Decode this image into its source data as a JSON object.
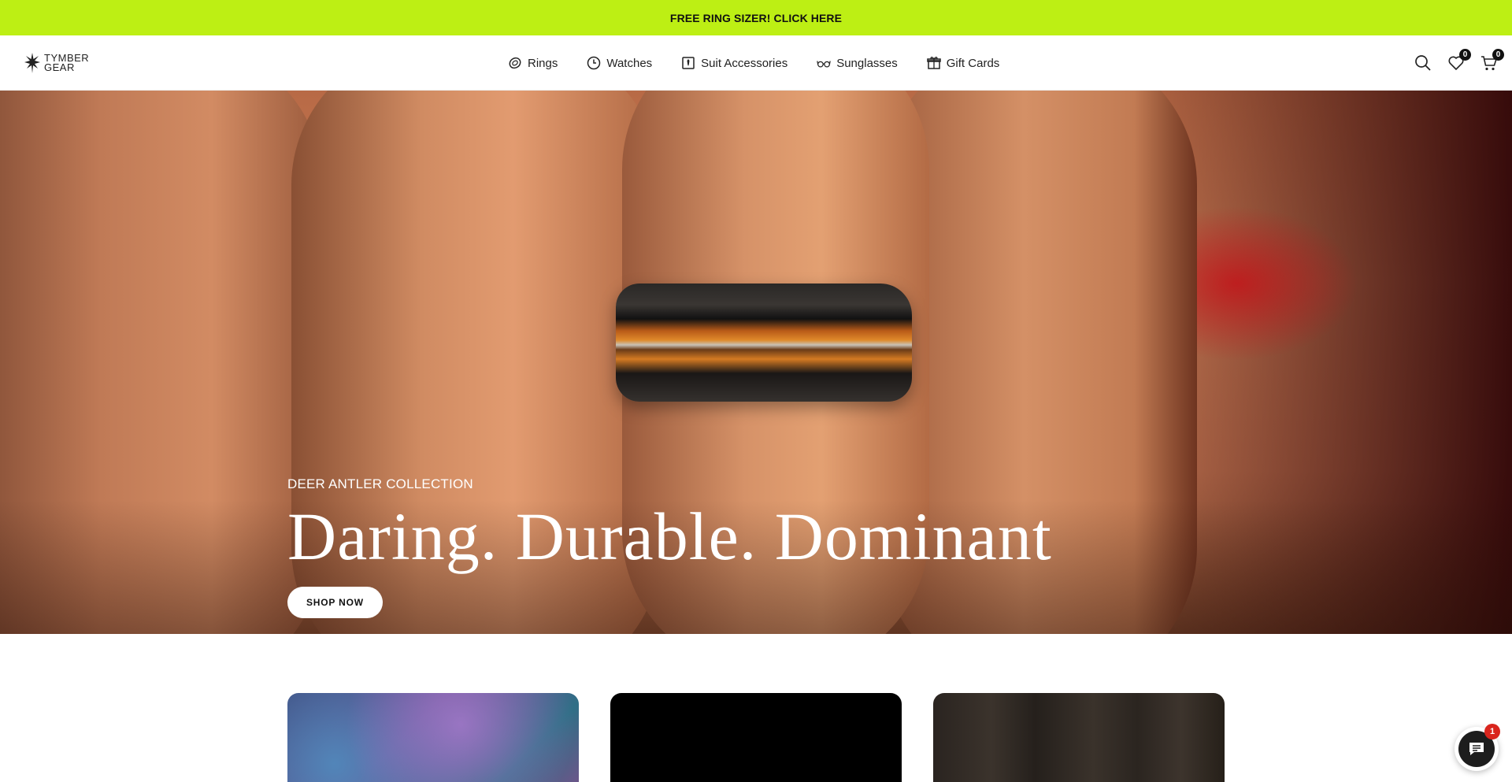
{
  "announcement": {
    "text": "FREE RING SIZER! CLICK HERE"
  },
  "brand": {
    "line1": "TYMBER",
    "line2": "GEAR"
  },
  "nav": {
    "items": [
      {
        "label": "Rings",
        "icon": "ring-icon"
      },
      {
        "label": "Watches",
        "icon": "clock-icon"
      },
      {
        "label": "Suit Accessories",
        "icon": "tie-box-icon"
      },
      {
        "label": "Sunglasses",
        "icon": "glasses-icon"
      },
      {
        "label": "Gift Cards",
        "icon": "gift-icon"
      }
    ]
  },
  "header_icons": {
    "wishlist_count": "0",
    "cart_count": "0"
  },
  "hero": {
    "subtitle": "DEER ANTLER COLLECTION",
    "title": "Daring. Durable. Dominant",
    "button": "SHOP NOW"
  },
  "chat": {
    "unread": "1"
  },
  "colors": {
    "announcement_bg": "#bdef14",
    "chat_badge": "#d9251d",
    "text_dark": "#111111"
  }
}
